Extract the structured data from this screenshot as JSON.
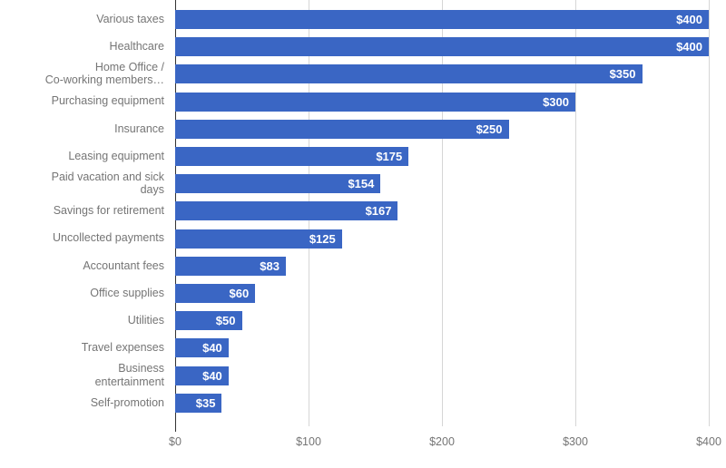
{
  "chart_data": {
    "type": "bar",
    "orientation": "horizontal",
    "title": "",
    "subtitle": "",
    "xlabel": "",
    "ylabel": "",
    "xlim": [
      0,
      400
    ],
    "grid": true,
    "legend": false,
    "value_prefix": "$",
    "axis_ticks": [
      "$0",
      "$100",
      "$200",
      "$300",
      "$400"
    ],
    "axis_tick_values": [
      0,
      100,
      200,
      300,
      400
    ],
    "categories": [
      "Various taxes",
      "Healthcare",
      "Home Office /\nCo-working members…",
      "Purchasing equipment",
      "Insurance",
      "Leasing equipment",
      "Paid vacation and sick\ndays",
      "Savings for retirement",
      "Uncollected payments",
      "Accountant fees",
      "Office supplies",
      "Utilities",
      "Travel expenses",
      "Business\nentertainment",
      "Self-promotion"
    ],
    "values": [
      400,
      400,
      350,
      300,
      250,
      175,
      154,
      167,
      125,
      83,
      60,
      50,
      40,
      40,
      35
    ],
    "value_labels": [
      "$400",
      "$400",
      "$350",
      "$300",
      "$250",
      "$175",
      "$154",
      "$167",
      "$125",
      "$83",
      "$60",
      "$50",
      "$40",
      "$40",
      "$35"
    ],
    "colors": {
      "bar": "#3a66c4",
      "value_label": "#ffffff",
      "category_label": "#757575",
      "tick_label": "#757575",
      "gridline": "#d6d6d6",
      "axis_line": "#333333",
      "background": "#ffffff"
    }
  }
}
